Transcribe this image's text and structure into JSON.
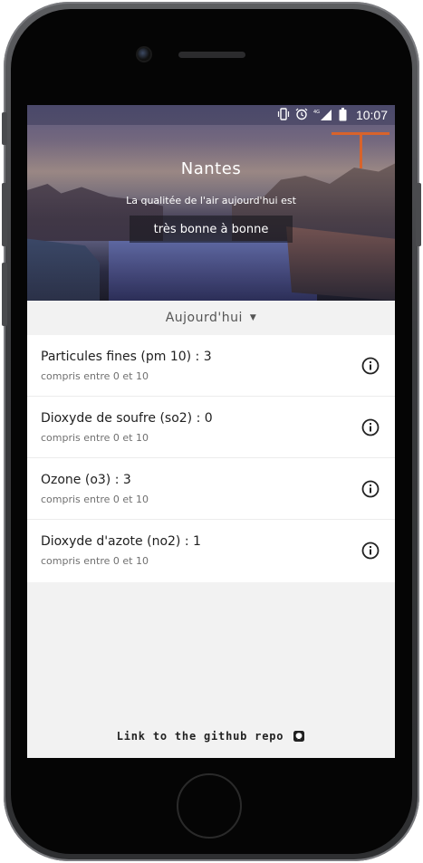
{
  "status_bar": {
    "time": "10:07",
    "icons": [
      "vibrate-icon",
      "alarm-icon",
      "4g-signal-icon",
      "battery-icon"
    ]
  },
  "hero": {
    "city": "Nantes",
    "subtitle": "La qualitée de l'air aujourd'hui est",
    "quality": "très bonne à bonne"
  },
  "period_selector": {
    "label": "Aujourd'hui",
    "icon": "caret-down-icon"
  },
  "pollutants": [
    {
      "title": "Particules fines (pm 10) : 3",
      "range": "compris entre 0 et 10",
      "icon": "info-icon"
    },
    {
      "title": "Dioxyde de soufre (so2) : 0",
      "range": "compris entre 0 et 10",
      "icon": "info-icon"
    },
    {
      "title": "Ozone (o3) : 3",
      "range": "compris entre 0 et 10",
      "icon": "info-icon"
    },
    {
      "title": "Dioxyde d'azote (no2) : 1",
      "range": "compris entre 0 et 10",
      "icon": "info-icon"
    }
  ],
  "footer": {
    "link_text": "Link to the github repo",
    "icon": "github-icon"
  },
  "colors": {
    "screen_bg": "#f2f2f2",
    "list_bg": "#ffffff",
    "text_primary": "#212121",
    "text_secondary": "#707070",
    "crane": "#d8632b"
  }
}
